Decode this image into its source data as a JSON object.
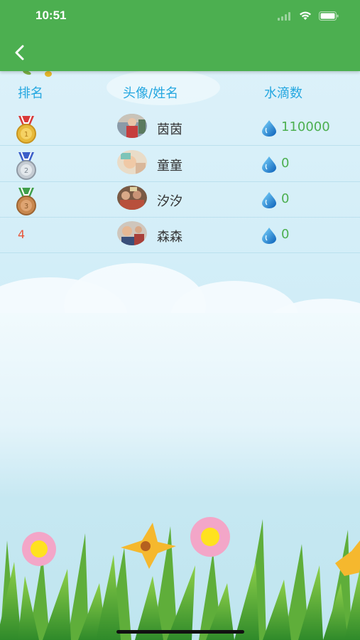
{
  "status_bar": {
    "time": "10:51"
  },
  "colors": {
    "header_green": "#4caf50",
    "score_green": "#4caf50",
    "header_text_blue": "#25a7e0",
    "rank_red": "#e8553a"
  },
  "table": {
    "headers": {
      "rank": "排名",
      "avatar_name": "头像/姓名",
      "water_drops": "水滴数"
    },
    "rows": [
      {
        "rank": "1",
        "rank_icon": "gold-medal-icon",
        "name": "茵茵",
        "score": "110000"
      },
      {
        "rank": "2",
        "rank_icon": "silver-medal-icon",
        "name": "童童",
        "score": "0"
      },
      {
        "rank": "3",
        "rank_icon": "bronze-medal-icon",
        "name": "汐汐",
        "score": "0"
      },
      {
        "rank": "4",
        "rank_icon": "",
        "name": "森森",
        "score": "0"
      }
    ]
  }
}
